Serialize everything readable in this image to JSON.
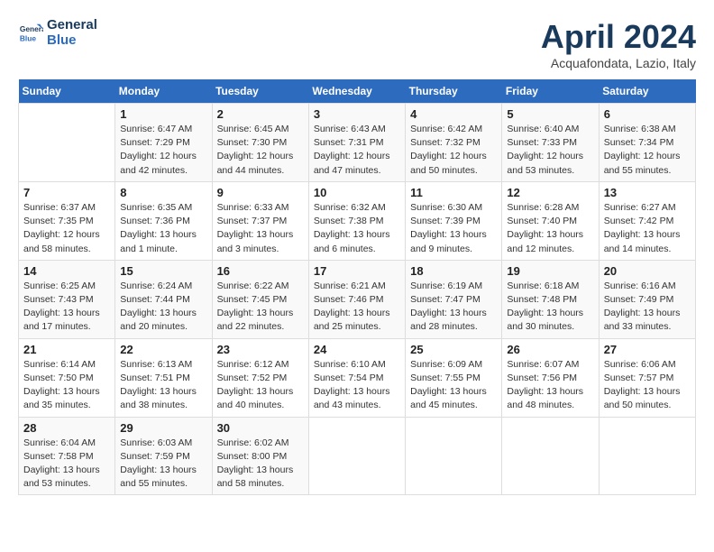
{
  "header": {
    "logo_line1": "General",
    "logo_line2": "Blue",
    "month_title": "April 2024",
    "location": "Acquafondata, Lazio, Italy"
  },
  "days_of_week": [
    "Sunday",
    "Monday",
    "Tuesday",
    "Wednesday",
    "Thursday",
    "Friday",
    "Saturday"
  ],
  "weeks": [
    [
      {
        "day": "",
        "sunrise": "",
        "sunset": "",
        "daylight": ""
      },
      {
        "day": "1",
        "sunrise": "Sunrise: 6:47 AM",
        "sunset": "Sunset: 7:29 PM",
        "daylight": "Daylight: 12 hours and 42 minutes."
      },
      {
        "day": "2",
        "sunrise": "Sunrise: 6:45 AM",
        "sunset": "Sunset: 7:30 PM",
        "daylight": "Daylight: 12 hours and 44 minutes."
      },
      {
        "day": "3",
        "sunrise": "Sunrise: 6:43 AM",
        "sunset": "Sunset: 7:31 PM",
        "daylight": "Daylight: 12 hours and 47 minutes."
      },
      {
        "day": "4",
        "sunrise": "Sunrise: 6:42 AM",
        "sunset": "Sunset: 7:32 PM",
        "daylight": "Daylight: 12 hours and 50 minutes."
      },
      {
        "day": "5",
        "sunrise": "Sunrise: 6:40 AM",
        "sunset": "Sunset: 7:33 PM",
        "daylight": "Daylight: 12 hours and 53 minutes."
      },
      {
        "day": "6",
        "sunrise": "Sunrise: 6:38 AM",
        "sunset": "Sunset: 7:34 PM",
        "daylight": "Daylight: 12 hours and 55 minutes."
      }
    ],
    [
      {
        "day": "7",
        "sunrise": "Sunrise: 6:37 AM",
        "sunset": "Sunset: 7:35 PM",
        "daylight": "Daylight: 12 hours and 58 minutes."
      },
      {
        "day": "8",
        "sunrise": "Sunrise: 6:35 AM",
        "sunset": "Sunset: 7:36 PM",
        "daylight": "Daylight: 13 hours and 1 minute."
      },
      {
        "day": "9",
        "sunrise": "Sunrise: 6:33 AM",
        "sunset": "Sunset: 7:37 PM",
        "daylight": "Daylight: 13 hours and 3 minutes."
      },
      {
        "day": "10",
        "sunrise": "Sunrise: 6:32 AM",
        "sunset": "Sunset: 7:38 PM",
        "daylight": "Daylight: 13 hours and 6 minutes."
      },
      {
        "day": "11",
        "sunrise": "Sunrise: 6:30 AM",
        "sunset": "Sunset: 7:39 PM",
        "daylight": "Daylight: 13 hours and 9 minutes."
      },
      {
        "day": "12",
        "sunrise": "Sunrise: 6:28 AM",
        "sunset": "Sunset: 7:40 PM",
        "daylight": "Daylight: 13 hours and 12 minutes."
      },
      {
        "day": "13",
        "sunrise": "Sunrise: 6:27 AM",
        "sunset": "Sunset: 7:42 PM",
        "daylight": "Daylight: 13 hours and 14 minutes."
      }
    ],
    [
      {
        "day": "14",
        "sunrise": "Sunrise: 6:25 AM",
        "sunset": "Sunset: 7:43 PM",
        "daylight": "Daylight: 13 hours and 17 minutes."
      },
      {
        "day": "15",
        "sunrise": "Sunrise: 6:24 AM",
        "sunset": "Sunset: 7:44 PM",
        "daylight": "Daylight: 13 hours and 20 minutes."
      },
      {
        "day": "16",
        "sunrise": "Sunrise: 6:22 AM",
        "sunset": "Sunset: 7:45 PM",
        "daylight": "Daylight: 13 hours and 22 minutes."
      },
      {
        "day": "17",
        "sunrise": "Sunrise: 6:21 AM",
        "sunset": "Sunset: 7:46 PM",
        "daylight": "Daylight: 13 hours and 25 minutes."
      },
      {
        "day": "18",
        "sunrise": "Sunrise: 6:19 AM",
        "sunset": "Sunset: 7:47 PM",
        "daylight": "Daylight: 13 hours and 28 minutes."
      },
      {
        "day": "19",
        "sunrise": "Sunrise: 6:18 AM",
        "sunset": "Sunset: 7:48 PM",
        "daylight": "Daylight: 13 hours and 30 minutes."
      },
      {
        "day": "20",
        "sunrise": "Sunrise: 6:16 AM",
        "sunset": "Sunset: 7:49 PM",
        "daylight": "Daylight: 13 hours and 33 minutes."
      }
    ],
    [
      {
        "day": "21",
        "sunrise": "Sunrise: 6:14 AM",
        "sunset": "Sunset: 7:50 PM",
        "daylight": "Daylight: 13 hours and 35 minutes."
      },
      {
        "day": "22",
        "sunrise": "Sunrise: 6:13 AM",
        "sunset": "Sunset: 7:51 PM",
        "daylight": "Daylight: 13 hours and 38 minutes."
      },
      {
        "day": "23",
        "sunrise": "Sunrise: 6:12 AM",
        "sunset": "Sunset: 7:52 PM",
        "daylight": "Daylight: 13 hours and 40 minutes."
      },
      {
        "day": "24",
        "sunrise": "Sunrise: 6:10 AM",
        "sunset": "Sunset: 7:54 PM",
        "daylight": "Daylight: 13 hours and 43 minutes."
      },
      {
        "day": "25",
        "sunrise": "Sunrise: 6:09 AM",
        "sunset": "Sunset: 7:55 PM",
        "daylight": "Daylight: 13 hours and 45 minutes."
      },
      {
        "day": "26",
        "sunrise": "Sunrise: 6:07 AM",
        "sunset": "Sunset: 7:56 PM",
        "daylight": "Daylight: 13 hours and 48 minutes."
      },
      {
        "day": "27",
        "sunrise": "Sunrise: 6:06 AM",
        "sunset": "Sunset: 7:57 PM",
        "daylight": "Daylight: 13 hours and 50 minutes."
      }
    ],
    [
      {
        "day": "28",
        "sunrise": "Sunrise: 6:04 AM",
        "sunset": "Sunset: 7:58 PM",
        "daylight": "Daylight: 13 hours and 53 minutes."
      },
      {
        "day": "29",
        "sunrise": "Sunrise: 6:03 AM",
        "sunset": "Sunset: 7:59 PM",
        "daylight": "Daylight: 13 hours and 55 minutes."
      },
      {
        "day": "30",
        "sunrise": "Sunrise: 6:02 AM",
        "sunset": "Sunset: 8:00 PM",
        "daylight": "Daylight: 13 hours and 58 minutes."
      },
      {
        "day": "",
        "sunrise": "",
        "sunset": "",
        "daylight": ""
      },
      {
        "day": "",
        "sunrise": "",
        "sunset": "",
        "daylight": ""
      },
      {
        "day": "",
        "sunrise": "",
        "sunset": "",
        "daylight": ""
      },
      {
        "day": "",
        "sunrise": "",
        "sunset": "",
        "daylight": ""
      }
    ]
  ]
}
